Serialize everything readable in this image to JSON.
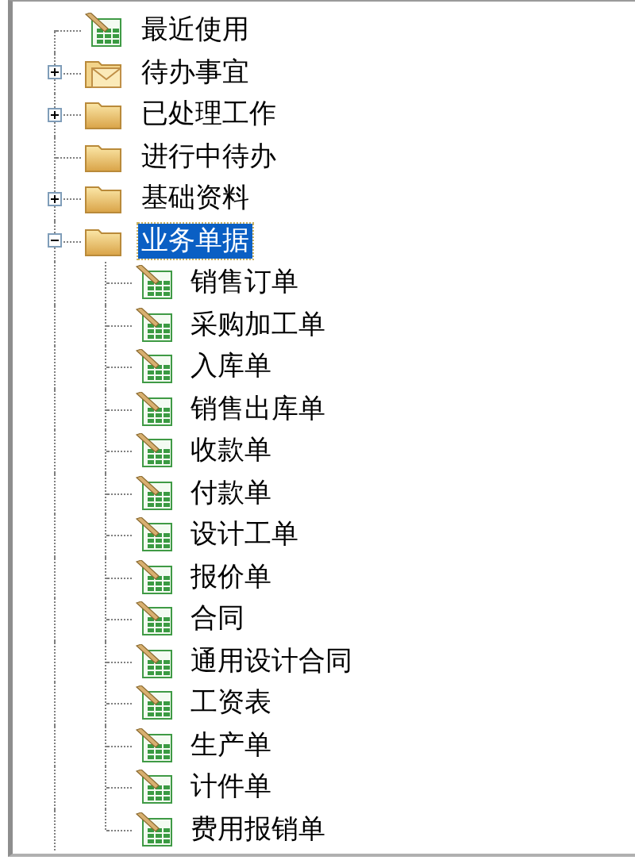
{
  "tree": [
    {
      "label": "最近使用",
      "kind": "document",
      "selected": false
    },
    {
      "label": "待办事宜",
      "kind": "mail",
      "expanded": false,
      "selected": false
    },
    {
      "label": "已处理工作",
      "kind": "folder",
      "expanded": false,
      "selected": false
    },
    {
      "label": "进行中待办",
      "kind": "folder",
      "selected": false
    },
    {
      "label": "基础资料",
      "kind": "folder",
      "expanded": false,
      "selected": false
    },
    {
      "label": "业务单据",
      "kind": "folder",
      "expanded": true,
      "selected": true,
      "children": [
        {
          "label": "销售订单",
          "kind": "document",
          "selected": false
        },
        {
          "label": "采购加工单",
          "kind": "document",
          "selected": false
        },
        {
          "label": "入库单",
          "kind": "document",
          "selected": false
        },
        {
          "label": "销售出库单",
          "kind": "document",
          "selected": false
        },
        {
          "label": "收款单",
          "kind": "document",
          "selected": false
        },
        {
          "label": "付款单",
          "kind": "document",
          "selected": false
        },
        {
          "label": "设计工单",
          "kind": "document",
          "selected": false
        },
        {
          "label": "报价单",
          "kind": "document",
          "selected": false
        },
        {
          "label": "合同",
          "kind": "document",
          "selected": false
        },
        {
          "label": "通用设计合同",
          "kind": "document",
          "selected": false
        },
        {
          "label": "工资表",
          "kind": "document",
          "selected": false
        },
        {
          "label": "生产单",
          "kind": "document",
          "selected": false
        },
        {
          "label": "计件单",
          "kind": "document",
          "selected": false
        },
        {
          "label": "费用报销单",
          "kind": "document",
          "selected": false
        }
      ]
    }
  ]
}
